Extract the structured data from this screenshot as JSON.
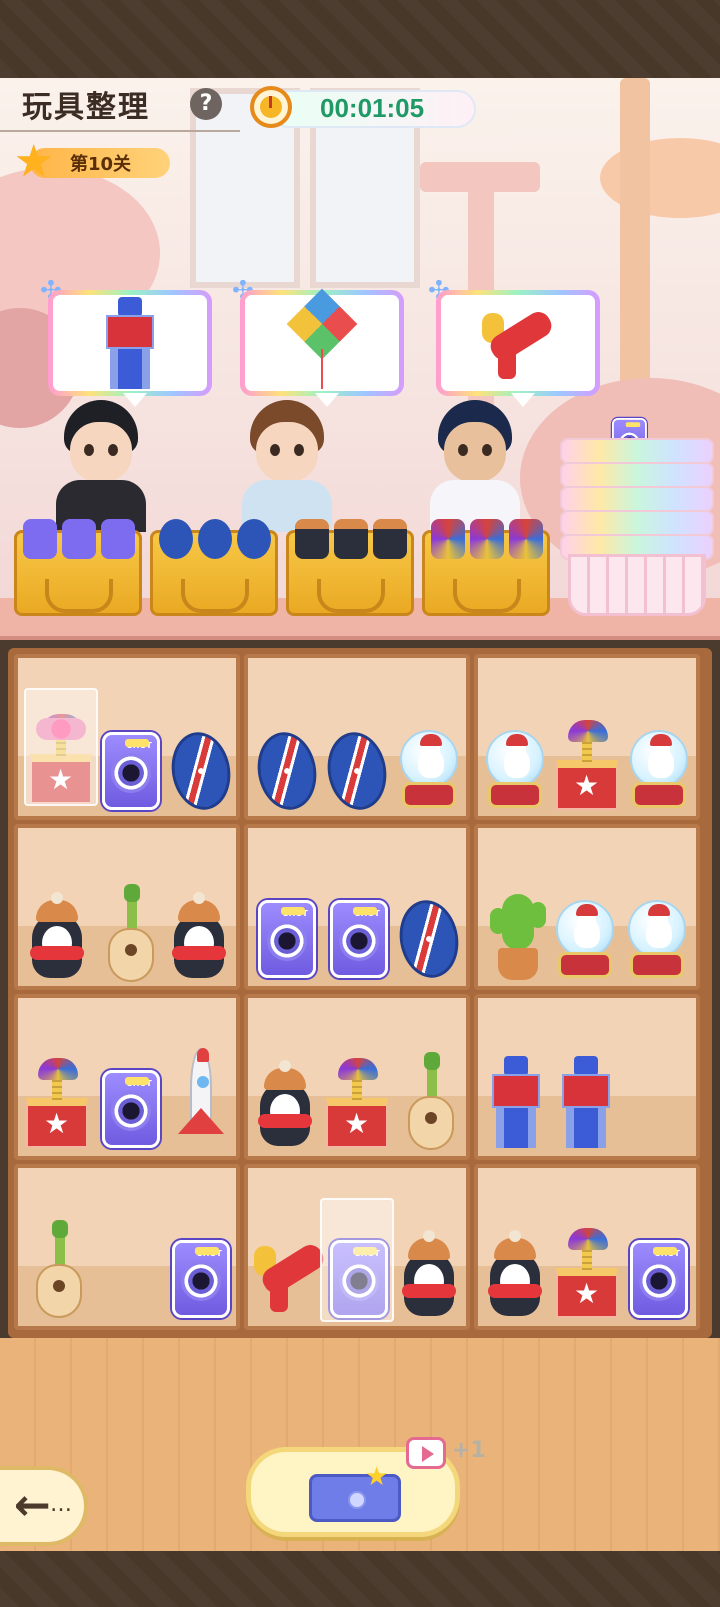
{
  "header": {
    "title": "玩具整理",
    "help_icon": "?",
    "timer": "00:01:05",
    "level": "第10关"
  },
  "customers": [
    {
      "wants": "robot-toy",
      "hair": "#1f1f26",
      "outfit": "#2a2a30"
    },
    {
      "wants": "kite",
      "hair": "#7a4a2a",
      "outfit": "#cfe2f2"
    },
    {
      "wants": "water-gun",
      "hair": "#1b2a4c",
      "outfit": "#f5f5fa"
    }
  ],
  "crates": [
    {
      "contents": "camera",
      "count": 3
    },
    {
      "contents": "football",
      "count": 3
    },
    {
      "contents": "penguin",
      "count": 3
    },
    {
      "contents": "jack-in-the-box",
      "count": 3
    }
  ],
  "basket_stack": {
    "count": 6,
    "top_item": "camera"
  },
  "shelves": [
    {
      "row": 1,
      "col": 1,
      "items": [
        "gift-box",
        "camera",
        "football"
      ]
    },
    {
      "row": 1,
      "col": 2,
      "items": [
        "football",
        "football",
        "snow-globe"
      ]
    },
    {
      "row": 1,
      "col": 3,
      "items": [
        "snow-globe",
        "jack-in-the-box",
        "snow-globe"
      ]
    },
    {
      "row": 2,
      "col": 1,
      "items": [
        "penguin",
        "ukulele",
        "penguin"
      ]
    },
    {
      "row": 2,
      "col": 2,
      "items": [
        "camera",
        "camera",
        "football"
      ]
    },
    {
      "row": 2,
      "col": 3,
      "items": [
        "cactus",
        "snow-globe",
        "snow-globe"
      ]
    },
    {
      "row": 3,
      "col": 1,
      "items": [
        "jack-in-the-box",
        "camera",
        "rocket"
      ]
    },
    {
      "row": 3,
      "col": 2,
      "items": [
        "penguin",
        "jack-in-the-box",
        "ukulele"
      ]
    },
    {
      "row": 3,
      "col": 3,
      "items": [
        "robot-toy",
        "robot-toy"
      ]
    },
    {
      "row": 4,
      "col": 1,
      "items": [
        "ukulele",
        "camera"
      ]
    },
    {
      "row": 4,
      "col": 2,
      "items": [
        "water-gun",
        "camera",
        "penguin"
      ]
    },
    {
      "row": 4,
      "col": 3,
      "items": [
        "penguin",
        "jack-in-the-box",
        "camera"
      ]
    }
  ],
  "bottom": {
    "back_label": "←",
    "back_dots": "…",
    "mystery_box_badge": "+1"
  },
  "colors": {
    "timer_text": "#1f9a66",
    "level_badge": "#ffb547",
    "shelf_wood": "#a86a3c"
  }
}
